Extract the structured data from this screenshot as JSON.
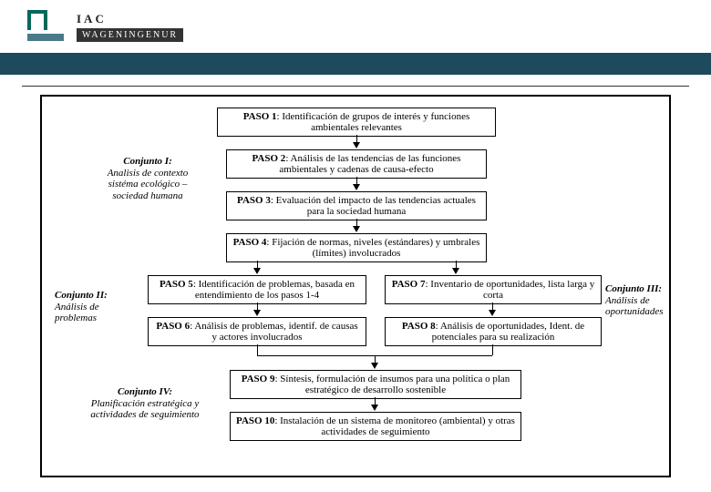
{
  "header": {
    "brand_iac": "IAC",
    "brand_wag": "WAGENINGENUR"
  },
  "steps": {
    "s1": "PASO 1: Identificación de grupos de interés y funciones ambientales relevantes",
    "s2": "PASO 2: Análisis de las tendencias de las funciones ambientales y cadenas de causa-efecto",
    "s3": "PASO 3: Evaluación del impacto de las tendencias actuales para la sociedad humana",
    "s4": "PASO 4: Fijación de normas, niveles (estándares) y umbrales (límites) involucrados",
    "s5": "PASO 5: Identificación de problemas, basada en entendimiento de los pasos 1-4",
    "s6": "PASO 6: Análisis de problemas, identif. de causas y actores involucrados",
    "s7": "PASO 7: Inventario de oportunidades, lista larga y corta",
    "s8": "PASO 8: Análisis de oportunidades, Ident. de potenciales para su realización",
    "s9": "PASO 9: Síntesis, formulación de insumos para una política o plan estratégico de desarrollo sostenible",
    "s10": "PASO 10: Instalación de un sistema de monitoreo (ambiental) y otras actividades de seguimiento"
  },
  "clusters": {
    "c1_title": "Conjunto I:",
    "c1_body": "Analisis de contexto sistéma ecológico – sociedad humana",
    "c2_title": "Conjunto II:",
    "c2_body": "Análisis de problemas",
    "c3_title": "Conjunto III:",
    "c3_body": "Análisis de oportunidades",
    "c4_title": "Conjunto IV:",
    "c4_body": "Planificación estratégica y actividades de seguimiento"
  }
}
